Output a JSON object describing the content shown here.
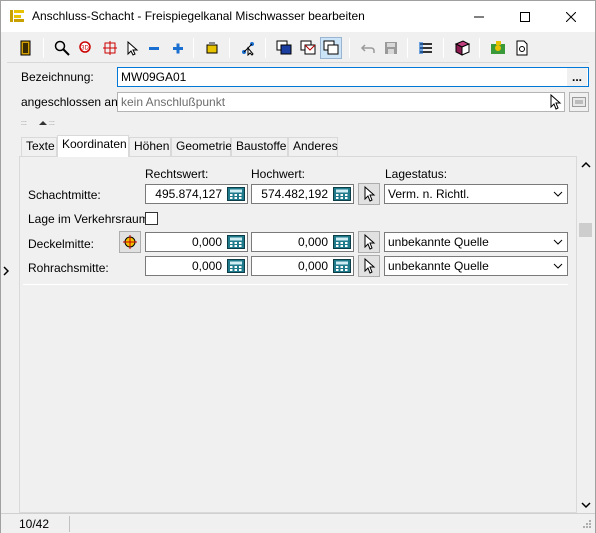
{
  "window": {
    "title": "Anschluss-Schacht - Freispiegelkanal Mischwasser bearbeiten",
    "minimize": "—",
    "maximize": "☐",
    "close": "✕"
  },
  "toolbar": {
    "icons": [
      "exit-icon",
      "zoom-icon",
      "zoom-area-icon",
      "crosshair-icon",
      "pointer-icon",
      "zoom-out-icon",
      "zoom-in-icon",
      "light-icon",
      "pick-icon",
      "window-front-icon",
      "window-mail-icon",
      "window-copy-icon",
      "undo-icon",
      "save-icon",
      "list-icon",
      "book-icon",
      "map-icon",
      "document-icon"
    ]
  },
  "header": {
    "bezeichnung_label": "Bezeichnung:",
    "bezeichnung_value": "MW09GA01",
    "more_button": "...",
    "angeschlossen_label": "angeschlossen an:",
    "angeschlossen_value": "kein Anschlußpunkt"
  },
  "tabs": [
    "Texte",
    "Koordinaten",
    "Höhen",
    "Geometrie",
    "Baustoffe",
    "Anderes"
  ],
  "active_tab": "Koordinaten",
  "koordinaten": {
    "col_rechtswert": "Rechtswert:",
    "col_hochwert": "Hochwert:",
    "col_lagestatus": "Lagestatus:",
    "schachtmitte_label": "Schachtmitte:",
    "schachtmitte_rechtswert": "495.874,127",
    "schachtmitte_hochwert": "574.482,192",
    "schachtmitte_status": "Verm. n. Richtl.",
    "lage_label": "Lage im Verkehrsraum",
    "deckelmitte_label": "Deckelmitte:",
    "deckelmitte_rechtswert": "0,000",
    "deckelmitte_hochwert": "0,000",
    "deckelmitte_status": "unbekannte Quelle",
    "rohrachsmitte_label": "Rohrachsmitte:",
    "rohrachsmitte_rechtswert": "0,000",
    "rohrachsmitte_hochwert": "0,000",
    "rohrachsmitte_status": "unbekannte Quelle"
  },
  "status": {
    "record": "10/42"
  },
  "colors": {
    "accent": "#0078d7",
    "calc_teal": "#1f7a8c"
  }
}
